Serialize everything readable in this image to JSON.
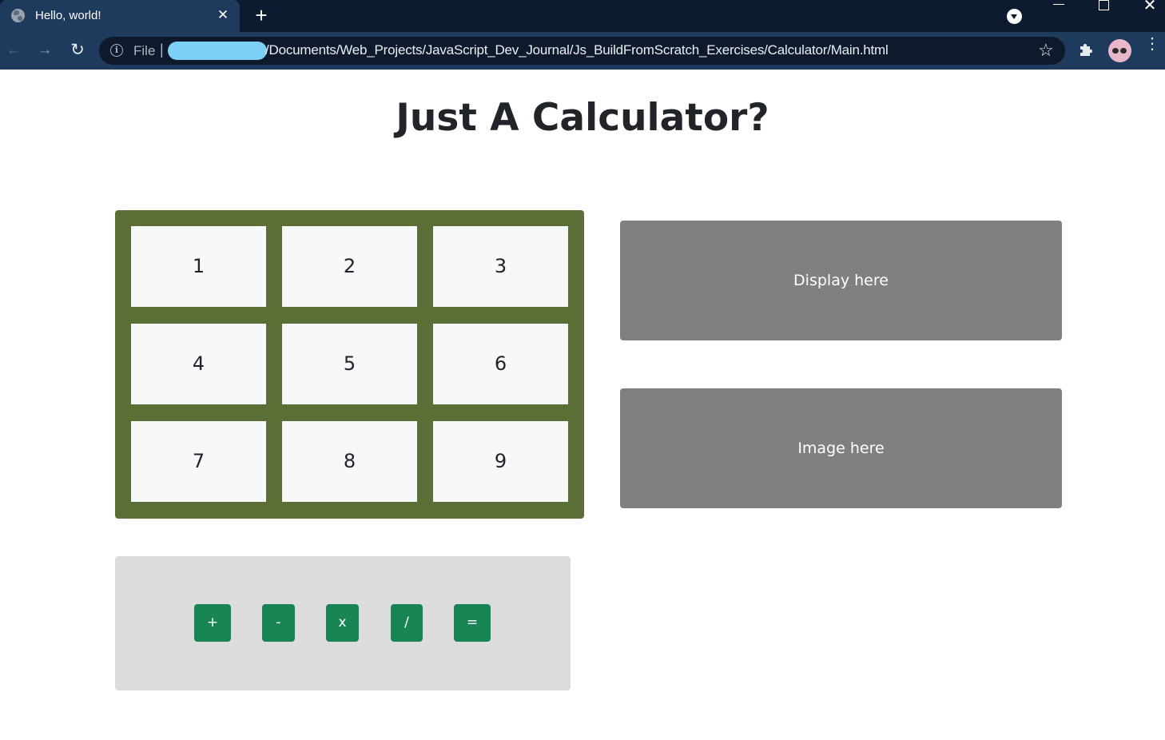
{
  "browser": {
    "tab": {
      "title": "Hello, world!",
      "close_glyph": "✕",
      "icon": "globe-icon"
    },
    "new_tab_glyph": "+",
    "nav": {
      "back_glyph": "←",
      "forward_glyph": "→",
      "reload_glyph": "↻"
    },
    "address_bar": {
      "info_glyph": "i",
      "scheme_label": "File",
      "separator": "|",
      "url": "/Documents/Web_Projects/JavaScript_Dev_Journal/Js_BuildFromScratch_Exercises/Calculator/Main.html",
      "bookmark_glyph": "☆"
    },
    "window_controls": {
      "close_glyph": "✕"
    },
    "menu_glyph": "⋮"
  },
  "page": {
    "title": "Just A Calculator?",
    "numpad": [
      "1",
      "2",
      "3",
      "4",
      "5",
      "6",
      "7",
      "8",
      "9"
    ],
    "operators": [
      "+",
      "-",
      "x",
      "/",
      "="
    ],
    "display_text": "Display here",
    "image_text": "Image here"
  },
  "colors": {
    "numpad_bg": "#5a6e35",
    "key_bg": "#f6f8fa",
    "operator_bg": "#1a8554",
    "ops_panel_bg": "#dcdcdc",
    "display_bg": "#808080",
    "chrome_dark": "#0d1b30",
    "chrome_tab": "#1e3a5c"
  }
}
